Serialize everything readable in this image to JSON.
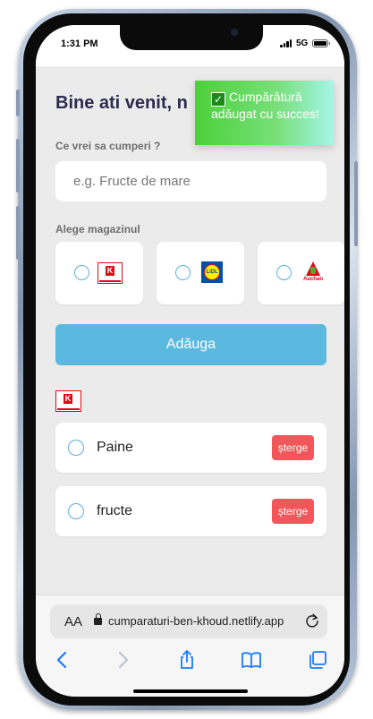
{
  "status_bar": {
    "time": "1:31 PM",
    "network": "5G"
  },
  "app": {
    "welcome": "Bine ati venit, n",
    "question_label": "Ce vrei sa cumperi ?",
    "search_placeholder": "e.g. Fructe de mare",
    "store_label": "Alege magazinul",
    "stores": [
      {
        "name": "Kaufland",
        "logo_text": "K",
        "logo_icon": "kaufland-logo"
      },
      {
        "name": "Lidl",
        "logo_text": "LiDL",
        "logo_icon": "lidl-logo"
      },
      {
        "name": "Auchan",
        "logo_text": "Auchan",
        "logo_icon": "auchan-logo"
      }
    ],
    "add_button": "Adăuga",
    "group_store": {
      "name": "Kaufland",
      "logo_text": "K"
    },
    "items": [
      {
        "name": "Paine",
        "delete_label": "șterge"
      },
      {
        "name": "fructe",
        "delete_label": "șterge"
      }
    ]
  },
  "toast": {
    "message": "Cumpărătură adăugat cu succes!",
    "check_symbol": "✓"
  },
  "safari": {
    "aa_label": "AA",
    "url": "cumparaturi-ben-khoud.netlify.app"
  },
  "colors": {
    "accent": "#5bb8df",
    "delete": "#f0565a",
    "toast_start": "#4cd13a",
    "toast_end": "#a5f5ea",
    "title": "#2c2c4e",
    "ios_blue": "#1a7cf5"
  }
}
